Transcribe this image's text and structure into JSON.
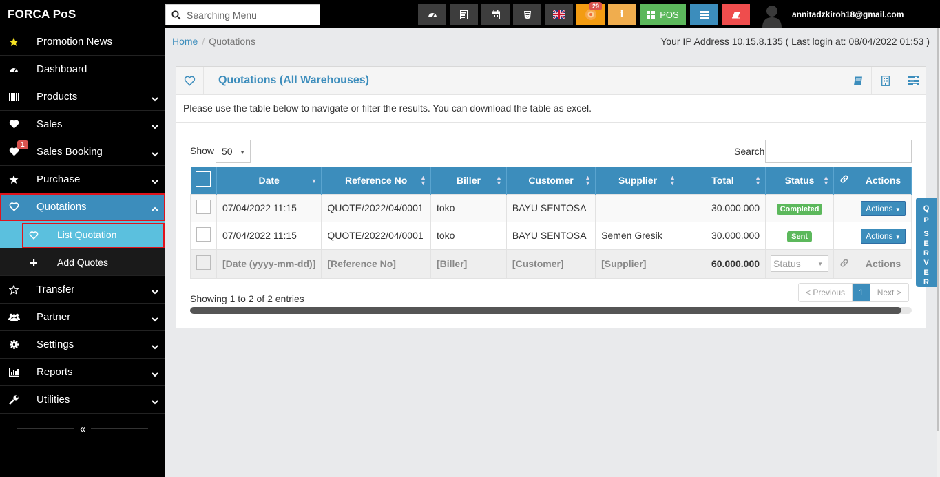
{
  "app": {
    "brand": "FORCA PoS"
  },
  "topbar": {
    "search_placeholder": "Searching Menu",
    "notification_count": "29",
    "pos_label": "POS",
    "user_email": "annitadzkiroh18@gmail.com",
    "icons": [
      "dashboard-icon",
      "calculator-icon",
      "calendar-icon",
      "css3-icon",
      "uk-flag-icon",
      "notification-icon",
      "info-icon",
      "pos-icon",
      "list-icon",
      "eraser-icon",
      "user-avatar"
    ],
    "colors": {
      "info": "#f0ad4e",
      "pos": "#5cb85c",
      "list": "#3c8dbc",
      "eraser": "#ef4d4d",
      "notif": "#f39c12"
    }
  },
  "sidebar": {
    "items": [
      {
        "label": "Promotion News",
        "icon": "star-icon"
      },
      {
        "label": "Dashboard",
        "icon": "dashboard-icon"
      },
      {
        "label": "Products",
        "icon": "barcode-icon"
      },
      {
        "label": "Sales",
        "icon": "heart-icon"
      },
      {
        "label": "Sales Booking",
        "icon": "heart-icon",
        "badge": "1"
      },
      {
        "label": "Purchase",
        "icon": "star-icon"
      },
      {
        "label": "Quotations",
        "icon": "heart-outline-icon"
      },
      {
        "label": "List Quotation",
        "icon": "heart-outline-icon"
      },
      {
        "label": "Add Quotes",
        "icon": "plus-icon"
      },
      {
        "label": "Transfer",
        "icon": "star-outline-icon"
      },
      {
        "label": "Partner",
        "icon": "users-icon"
      },
      {
        "label": "Settings",
        "icon": "cog-icon"
      },
      {
        "label": "Reports",
        "icon": "bar-chart-icon"
      },
      {
        "label": "Utilities",
        "icon": "wrench-icon"
      }
    ],
    "collapse_symbol": "«"
  },
  "breadcrumb": {
    "home": "Home",
    "current": "Quotations"
  },
  "ip_info": "Your IP Address 10.15.8.135 ( Last login at: 08/04/2022 01:53 )",
  "box": {
    "title": "Quotations (All Warehouses)",
    "intro": "Please use the table below to navigate or filter the results. You can download the table as excel.",
    "show_label": "Show",
    "page_length": "50",
    "search_label": "Search"
  },
  "table": {
    "headers": [
      "Date",
      "Reference No",
      "Biller",
      "Customer",
      "Supplier",
      "Total",
      "Status",
      "Actions"
    ],
    "rows": [
      {
        "date": "07/04/2022 11:15",
        "ref": "QUOTE/2022/04/0001",
        "biller": "toko",
        "customer": "BAYU SENTOSA",
        "supplier": "",
        "total": "30.000.000",
        "status": "Completed",
        "action": "Actions"
      },
      {
        "date": "07/04/2022 11:15",
        "ref": "QUOTE/2022/04/0001",
        "biller": "toko",
        "customer": "BAYU SENTOSA",
        "supplier": "Semen Gresik",
        "total": "30.000.000",
        "status": "Sent",
        "action": "Actions"
      }
    ],
    "footer": {
      "date": "[Date (yyyy-mm-dd)]",
      "ref": "[Reference No]",
      "biller": "[Biller]",
      "customer": "[Customer]",
      "supplier": "[Supplier]",
      "total": "60.000.000",
      "status": "Status",
      "action": "Actions"
    }
  },
  "pagination": {
    "info": "Showing 1 to 2 of 2 entries",
    "prev": "< Previous",
    "current": "1",
    "next": "Next >"
  },
  "side_tab": {
    "letters": [
      "Q",
      "P",
      "",
      "S",
      "E",
      "R",
      "V",
      "E",
      "R"
    ]
  }
}
